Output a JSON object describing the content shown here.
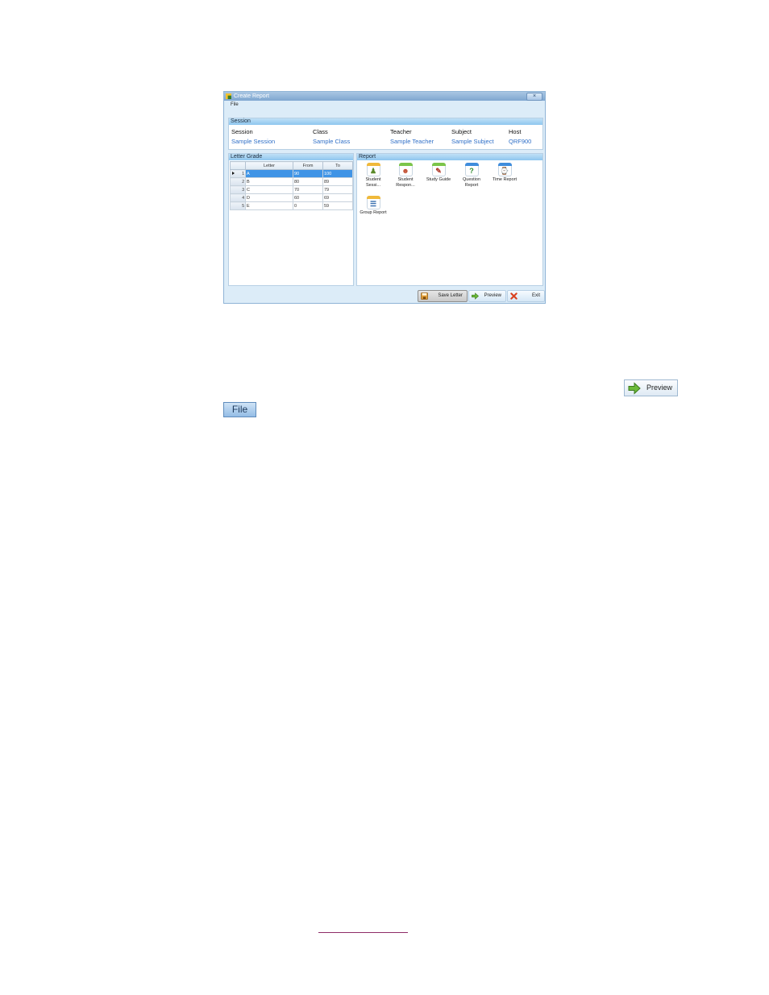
{
  "window": {
    "title": "Create Report",
    "close_glyph": "×",
    "menu": [
      "File"
    ]
  },
  "session_panel": {
    "header": "Session",
    "columns": [
      {
        "label": "Session",
        "value": "Sample Session"
      },
      {
        "label": "Class",
        "value": "Sample Class"
      },
      {
        "label": "Teacher",
        "value": "Sample Teacher"
      },
      {
        "label": "Subject",
        "value": "Sample Subject"
      },
      {
        "label": "Host",
        "value": "QRF900"
      }
    ]
  },
  "letter_grade_panel": {
    "header": "Letter Grade",
    "columns": [
      "Letter",
      "From",
      "To"
    ],
    "rows": [
      {
        "num": "1",
        "letter": "A",
        "from": "90",
        "to": "100",
        "selected": true
      },
      {
        "num": "2",
        "letter": "B",
        "from": "80",
        "to": "89"
      },
      {
        "num": "3",
        "letter": "C",
        "from": "70",
        "to": "79"
      },
      {
        "num": "4",
        "letter": "D",
        "from": "60",
        "to": "69"
      },
      {
        "num": "5",
        "letter": "E",
        "from": "0",
        "to": "59"
      }
    ]
  },
  "report_panel": {
    "header": "Report",
    "items": [
      {
        "line1": "Student",
        "line2": "Sessi...",
        "icon": "student-session-icon",
        "band": "#f0b93a",
        "glyph": "♟",
        "glyph_color": "#5a8a2a"
      },
      {
        "line1": "Student",
        "line2": "Respon...",
        "icon": "student-response-icon",
        "band": "#7cc54a",
        "glyph": "☻",
        "glyph_color": "#c0492b"
      },
      {
        "line1": "Study Guide",
        "line2": "",
        "icon": "study-guide-icon",
        "band": "#7cc54a",
        "glyph": "✎",
        "glyph_color": "#b0392b"
      },
      {
        "line1": "Question",
        "line2": "Report",
        "icon": "question-report-icon",
        "band": "#3f8ddc",
        "glyph": "?",
        "glyph_color": "#2f8a2f"
      },
      {
        "line1": "Time Report",
        "line2": "",
        "icon": "time-report-icon",
        "band": "#3f8ddc",
        "glyph": "⌚",
        "glyph_color": "#3a6fb0"
      },
      {
        "line1": "Group Report",
        "line2": "",
        "icon": "group-report-icon",
        "band": "#f0b93a",
        "glyph": "☰",
        "glyph_color": "#3a6fb0"
      }
    ]
  },
  "footer": {
    "save_label": "Save Letter",
    "preview_label": "Preview",
    "exit_label": "Exit"
  },
  "standalone": {
    "preview_label": "Preview",
    "file_label": "File"
  }
}
